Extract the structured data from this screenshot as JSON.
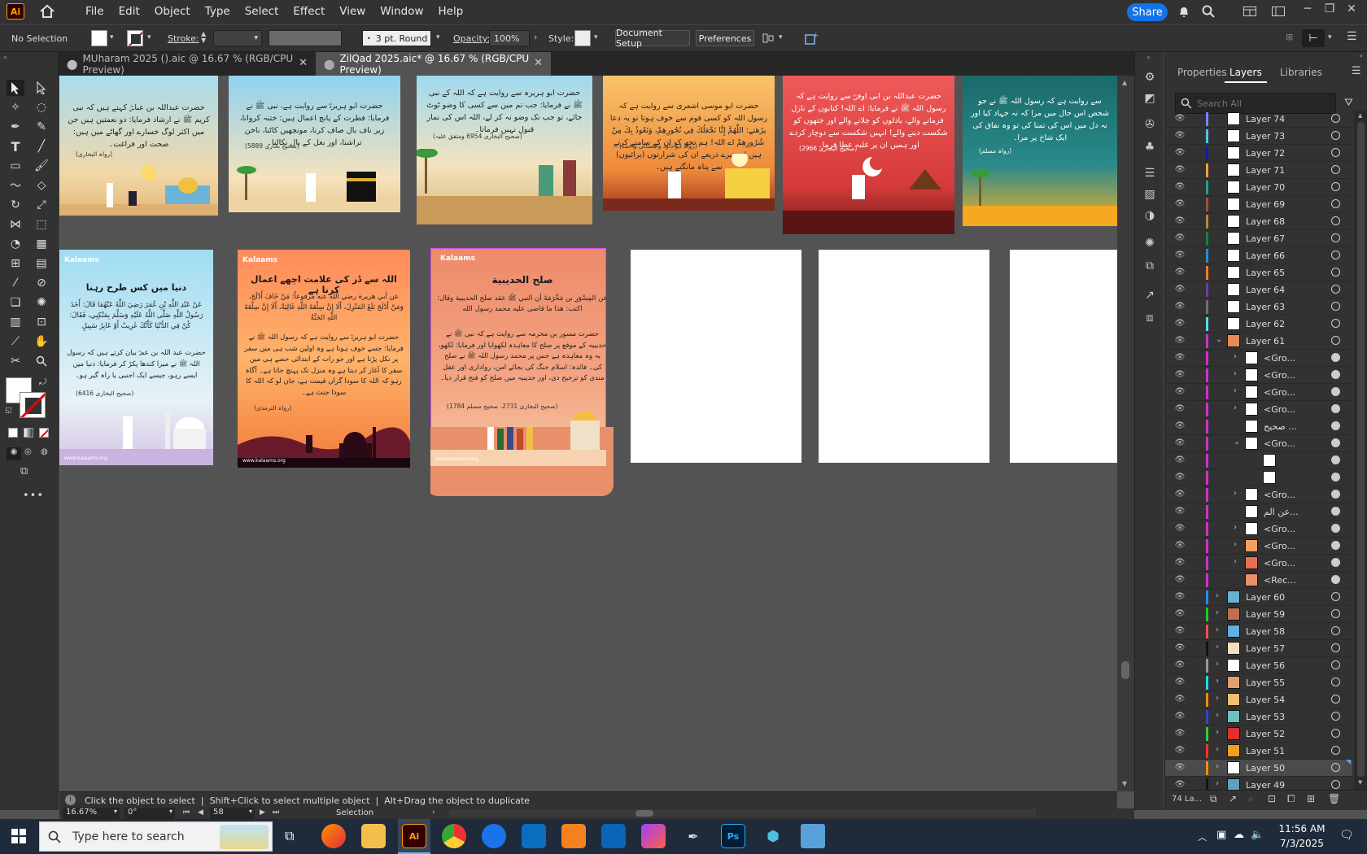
{
  "app": {
    "logo": "Ai"
  },
  "menus": [
    "File",
    "Edit",
    "Object",
    "Type",
    "Select",
    "Effect",
    "View",
    "Window",
    "Help"
  ],
  "share_label": "Share",
  "control": {
    "selection": "No Selection",
    "stroke_label": "Stroke:",
    "brush": "3 pt. Round",
    "opacity_label": "Opacity:",
    "opacity_value": "100%",
    "style_label": "Style:",
    "document_setup": "Document Setup",
    "preferences": "Preferences"
  },
  "tabs": [
    {
      "label": "MUharam 2025 ().aic @ 16.67 % (RGB/CPU Preview)",
      "active": false
    },
    {
      "label": "ZilQad 2025.aic* @ 16.67 % (RGB/CPU Preview)",
      "active": true
    }
  ],
  "panel": {
    "tabs": [
      "Properties",
      "Layers",
      "Libraries"
    ],
    "active_tab": "Layers",
    "search_placeholder": "Search All",
    "footer_count": "74 La..."
  },
  "layers": [
    {
      "name": "Layer 74",
      "color": "#7f7fff",
      "depth": 0,
      "expand": "none",
      "thumb": "#ffffff"
    },
    {
      "name": "Layer 73",
      "color": "#4fc4ff",
      "depth": 0,
      "expand": "none",
      "thumb": "#ffffff"
    },
    {
      "name": "Layer 72",
      "color": "#1a1aa0",
      "depth": 0,
      "expand": "none",
      "thumb": "#ffffff"
    },
    {
      "name": "Layer 71",
      "color": "#ff9e3d",
      "depth": 0,
      "expand": "none",
      "thumb": "#ffffff"
    },
    {
      "name": "Layer 70",
      "color": "#1fa0a0",
      "depth": 0,
      "expand": "none",
      "thumb": "#ffffff"
    },
    {
      "name": "Layer 69",
      "color": "#a0522d",
      "depth": 0,
      "expand": "none",
      "thumb": "#ffffff"
    },
    {
      "name": "Layer 68",
      "color": "#c08040",
      "depth": 0,
      "expand": "none",
      "thumb": "#ffffff"
    },
    {
      "name": "Layer 67",
      "color": "#1a7f3d",
      "depth": 0,
      "expand": "none",
      "thumb": "#ffffff"
    },
    {
      "name": "Layer 66",
      "color": "#1e8fd6",
      "depth": 0,
      "expand": "none",
      "thumb": "#ffffff"
    },
    {
      "name": "Layer 65",
      "color": "#ff7f1f",
      "depth": 0,
      "expand": "none",
      "thumb": "#ffffff"
    },
    {
      "name": "Layer 64",
      "color": "#6b3fa0",
      "depth": 0,
      "expand": "none",
      "thumb": "#ffffff"
    },
    {
      "name": "Layer 63",
      "color": "#707070",
      "depth": 0,
      "expand": "none",
      "thumb": "#ffffff"
    },
    {
      "name": "Layer 62",
      "color": "#4fe0ff",
      "depth": 0,
      "expand": "none",
      "thumb": "#ffffff"
    },
    {
      "name": "Layer 61",
      "color": "#cc33cc",
      "depth": 0,
      "expand": "open",
      "thumb": "#e88a5a"
    },
    {
      "name": "<Gro...",
      "color": "#cc33cc",
      "depth": 1,
      "expand": "closed",
      "thumb": "#ffffff"
    },
    {
      "name": "<Gro...",
      "color": "#cc33cc",
      "depth": 1,
      "expand": "closed",
      "thumb": "#ffffff"
    },
    {
      "name": "<Gro...",
      "color": "#cc33cc",
      "depth": 1,
      "expand": "closed",
      "thumb": "#ffffff"
    },
    {
      "name": "<Gro...",
      "color": "#cc33cc",
      "depth": 1,
      "expand": "closed",
      "thumb": "#ffffff"
    },
    {
      "name": "صحیح ...",
      "color": "#cc33cc",
      "depth": 1,
      "expand": "none",
      "thumb": "#ffffff"
    },
    {
      "name": "<Gro...",
      "color": "#cc33cc",
      "depth": 1,
      "expand": "open",
      "thumb": "#ffffff"
    },
    {
      "name": "",
      "color": "#cc33cc",
      "depth": 2,
      "expand": "none",
      "thumb": "#ffffff"
    },
    {
      "name": "",
      "color": "#cc33cc",
      "depth": 2,
      "expand": "none",
      "thumb": "#ffffff"
    },
    {
      "name": "<Gro...",
      "color": "#cc33cc",
      "depth": 1,
      "expand": "closed",
      "thumb": "#ffffff"
    },
    {
      "name": "عن الم...",
      "color": "#cc33cc",
      "depth": 1,
      "expand": "none",
      "thumb": "#ffffff"
    },
    {
      "name": "<Gro...",
      "color": "#cc33cc",
      "depth": 1,
      "expand": "closed",
      "thumb": "#ffffff"
    },
    {
      "name": "<Gro...",
      "color": "#cc33cc",
      "depth": 1,
      "expand": "closed",
      "thumb": "#f4a060"
    },
    {
      "name": "<Gro...",
      "color": "#cc33cc",
      "depth": 1,
      "expand": "closed",
      "thumb": "#e87050"
    },
    {
      "name": "<Rec...",
      "color": "#cc33cc",
      "depth": 1,
      "expand": "none",
      "thumb": "#e8906a"
    },
    {
      "name": "Layer 60",
      "color": "#1e90ff",
      "depth": 0,
      "expand": "closed",
      "thumb": "#6ab0d0"
    },
    {
      "name": "Layer 59",
      "color": "#22cc22",
      "depth": 0,
      "expand": "closed",
      "thumb": "#c07050"
    },
    {
      "name": "Layer 58",
      "color": "#ff5050",
      "depth": 0,
      "expand": "closed",
      "thumb": "#60b0e0"
    },
    {
      "name": "Layer 57",
      "color": "#111111",
      "depth": 0,
      "expand": "closed",
      "thumb": "#f0e0c0"
    },
    {
      "name": "Layer 56",
      "color": "#999999",
      "depth": 0,
      "expand": "closed",
      "thumb": "#ffffff"
    },
    {
      "name": "Layer 55",
      "color": "#22dddd",
      "depth": 0,
      "expand": "closed",
      "thumb": "#e0a070"
    },
    {
      "name": "Layer 54",
      "color": "#ff8c00",
      "depth": 0,
      "expand": "closed",
      "thumb": "#f0c070"
    },
    {
      "name": "Layer 53",
      "color": "#3344cc",
      "depth": 0,
      "expand": "closed",
      "thumb": "#70c0c0"
    },
    {
      "name": "Layer 52",
      "color": "#33cc33",
      "depth": 0,
      "expand": "closed",
      "thumb": "#e03030"
    },
    {
      "name": "Layer 51",
      "color": "#ff3333",
      "depth": 0,
      "expand": "closed",
      "thumb": "#f0a020"
    },
    {
      "name": "Layer 50",
      "color": "#ff8c00",
      "depth": 0,
      "expand": "closed",
      "thumb": "#ffffff",
      "selected": true
    },
    {
      "name": "Layer 49",
      "color": "#111111",
      "depth": 0,
      "expand": "closed",
      "thumb": "#60a0c0"
    }
  ],
  "artboards": {
    "top": [
      {
        "text": "حضرت عبداللہ بن عباسؓ کہتے ہیں کہ نبی کریم ﷺ نے ارشاد فرمایا: دو نعمتیں ہیں جن میں اکثر لوگ خسارے اور گھاٹے میں ہیں: صحت اور فراغت۔",
        "ref": "(رواہ البخاری)"
      },
      {
        "text": "حضرت ابو ہریرہؓ سے روایت ہے، نبی ﷺ نے فرمایا: فطرت کے پانچ اعمال ہیں: ختنہ کروانا، زیر ناف بال صاف کرنا، مونچھیں کاٹنا، ناخن تراشنا، اور بغل کے بال نکالنا۔",
        "ref": "(صحیح بخاری 5889)"
      },
      {
        "text": "حضرت ابو ہریرہ سے روایت ہے کہ اللہ کے نبی ﷺ نے فرمایا: جب تم میں سے کسی کا وضو ٹوٹ جائے، تو جب تک وضو نہ کر لے، اللہ اس کی نماز قبول نہیں فرماتا۔",
        "ref": "(صحیح البخاری 6954 ومتفق علیہ)"
      },
      {
        "text": "حضرت ابو موسی اشعری سے روایت ہے کہ رسول اللہ کو کسی قوم سے خوف ہوتا تو یہ دعا پڑھتے: اللَّهُمَّ إِنَّا نَجْعَلُكَ فِي نُحُورِهِمْ، وَنَعُوذُ بِكَ مِنْ شُرُورِهِمْ اے اللہ! ہم تجھ کو ان کے سامنے کرتے ہیں اور تیرے ذریعے ان کی شرارتوں (برائیوں) سے پناہ مانگتے ہیں۔",
        "ref": "(رواہ ابو داود والنسائی واحمد)"
      },
      {
        "text": "حضرت عبداللہ بن ابی اوفیؓ سے روایت ہے کہ رسول اللہ ﷺ نے فرمایا: اے اللہ! کتابوں کے نازل فرمانے والے، بادلوں کو چلانے والے اور جتھوں کو شکست دینے والے! انہیں شکست سے دوچار کردے اور ہمیں ان پر غلبہ عطا فرما۔",
        "ref": "(صحیح البخاری 2966)"
      },
      {
        "text": "سے روایت ہے کہ رسول اللہ ﷺ نے جو شخص اس حال میں مرا کہ نہ جہاد کیا اور نہ دل میں اس کی تمنا کی تو وہ نفاق کی ایک شاخ پر مرا۔",
        "ref": "(رواہ مسلم)"
      }
    ],
    "bottom": [
      {
        "logo": "Kalaams",
        "title": "دنیا میں کس طرح رہنا",
        "arabic": "عَنْ عَبْدِ اللَّهِ بْنِ عُمَرَ رَضِيَ اللَّهُ عَنْهُمَا قَالَ: أَخَذَ رَسُولُ اللَّهِ صَلَّى اللَّهُ عَلَيْهِ وَسَلَّمَ بِمَنْكِبِي، فَقَالَ: كُنْ فِي الدُّنْيَا كَأَنَّكَ غَرِيبٌ أَوْ عَابِرُ سَبِيلٍ",
        "urdu": "حضرت عبد اللہ بن عمرؓ بیان کرتے ہیں کہ رسول اللہ ﷺ نے میرا کندھا پکڑ کر فرمایا: دنیا میں ایسے رہو، جیسے ایک اجنبی یا راہ گیر ہو۔",
        "ref": "(صحیح البخاری 6416)",
        "url": "www.kalaams.org"
      },
      {
        "logo": "Kalaams",
        "title": "اللہ سے ڈر کی علامت اچھے اعمال کرنا ہے",
        "arabic": "عن أبي هريرة رضي الله عنه مرفوعاً: مَنْ خَافَ أَدْلَجَ، وَمَنْ أَدْلَجَ بَلَغَ المَنْزِلَ، أَلَا إِنَّ سِلْعَةَ اللَّهِ غَالِيَةٌ، أَلَا إِنَّ سِلْعَةَ اللَّهِ الجَنَّةُ",
        "urdu": "حضرت ابو ہریرہؓ سے روایت ہے کہ رسول اللہ ﷺ نے فرمایا: جسے خوف ہوتا ہے وہ اولین شب ہی میں سفر پر نکل پڑتا ہے اور جو رات کے ابتدائی حصے ہی میں سفر کا آغاز کر دیتا ہے وہ منزل تک پہنچ جاتا ہے۔ آگاہ رہو کہ اللہ کا سودا گراں قیمت ہے، جان لو کہ اللہ کا سودا جنت ہے۔",
        "ref": "(رواہ الترمذی)",
        "url": "www.kalaams.org"
      },
      {
        "logo": "Kalaams",
        "title": "صلح الحديبية",
        "arabic": "عن المِسْوَرِ بن مَخْرَمَةَ أن النبي ﷺ عقد صلح الحديبية وقال: اكتب: هذا ما قاضى عليه محمد رسول الله",
        "urdu": "حضرت مسور بن مخرمہ سے روایت ہے کہ نبی ﷺ نے حدیبیہ کے موقع پر صلح کا معاہدہ لکھوایا اور فرمایا: لکھو، یہ وہ معاہدہ ہے جس پر محمد رسول اللہ ﷺ نے صلح کی۔ فائدہ: اسلام جنگ کی بجائے امن، رواداری اور عقل مندی کو ترجیح دی، اور حدیبیہ میں صلح کو فتح قرار دیا۔",
        "ref": "(صحیح البخاری 2731، صحیح مسلم 1784)",
        "url": "www.kalaams.org"
      }
    ]
  },
  "status": {
    "hint": "Click the object to select  |  Shift+Click to select multiple object  |  Alt+Drag the object to duplicate",
    "zoom": "16.67%",
    "rotation": "0°",
    "artboard": "58",
    "tool": "Selection"
  },
  "taskbar": {
    "search_placeholder": "Type here to search",
    "time": "11:56 AM",
    "date": "7/3/2025",
    "apps": [
      "Ai",
      "Ps"
    ]
  }
}
